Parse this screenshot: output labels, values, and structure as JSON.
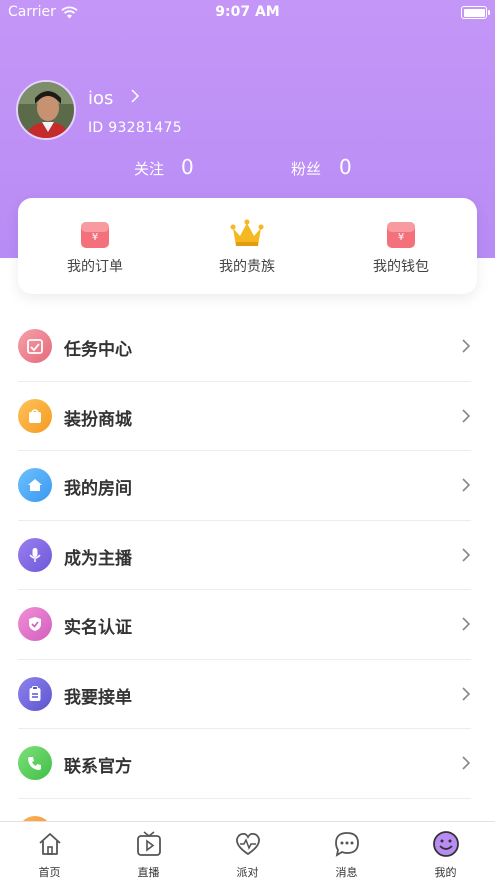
{
  "status_bar": {
    "carrier": "Carrier",
    "time": "9:07 AM"
  },
  "profile": {
    "username": "ios",
    "user_id": "ID 93281475",
    "following_label": "关注",
    "following_count": "0",
    "fans_label": "粉丝",
    "fans_count": "0"
  },
  "quick_actions": [
    {
      "label": "我的订单",
      "icon": "red-envelope-icon"
    },
    {
      "label": "我的贵族",
      "icon": "crown-icon"
    },
    {
      "label": "我的钱包",
      "icon": "wallet-envelope-icon"
    }
  ],
  "menu": [
    {
      "label": "任务中心",
      "icon": "task-icon"
    },
    {
      "label": "装扮商城",
      "icon": "shop-bag-icon"
    },
    {
      "label": "我的房间",
      "icon": "home-icon"
    },
    {
      "label": "成为主播",
      "icon": "microphone-icon"
    },
    {
      "label": "实名认证",
      "icon": "shield-check-icon"
    },
    {
      "label": "我要接单",
      "icon": "clipboard-icon"
    },
    {
      "label": "联系官方",
      "icon": "phone-icon"
    }
  ],
  "tabs": [
    {
      "label": "首页",
      "icon": "home-outline-icon"
    },
    {
      "label": "直播",
      "icon": "tv-play-icon"
    },
    {
      "label": "派对",
      "icon": "heartbeat-icon"
    },
    {
      "label": "消息",
      "icon": "chat-bubble-icon"
    },
    {
      "label": "我的",
      "icon": "smiley-icon",
      "active": true
    }
  ],
  "colors": {
    "header_purple": "#bf92f6",
    "text_dark": "#333333",
    "divider": "#ececec"
  }
}
